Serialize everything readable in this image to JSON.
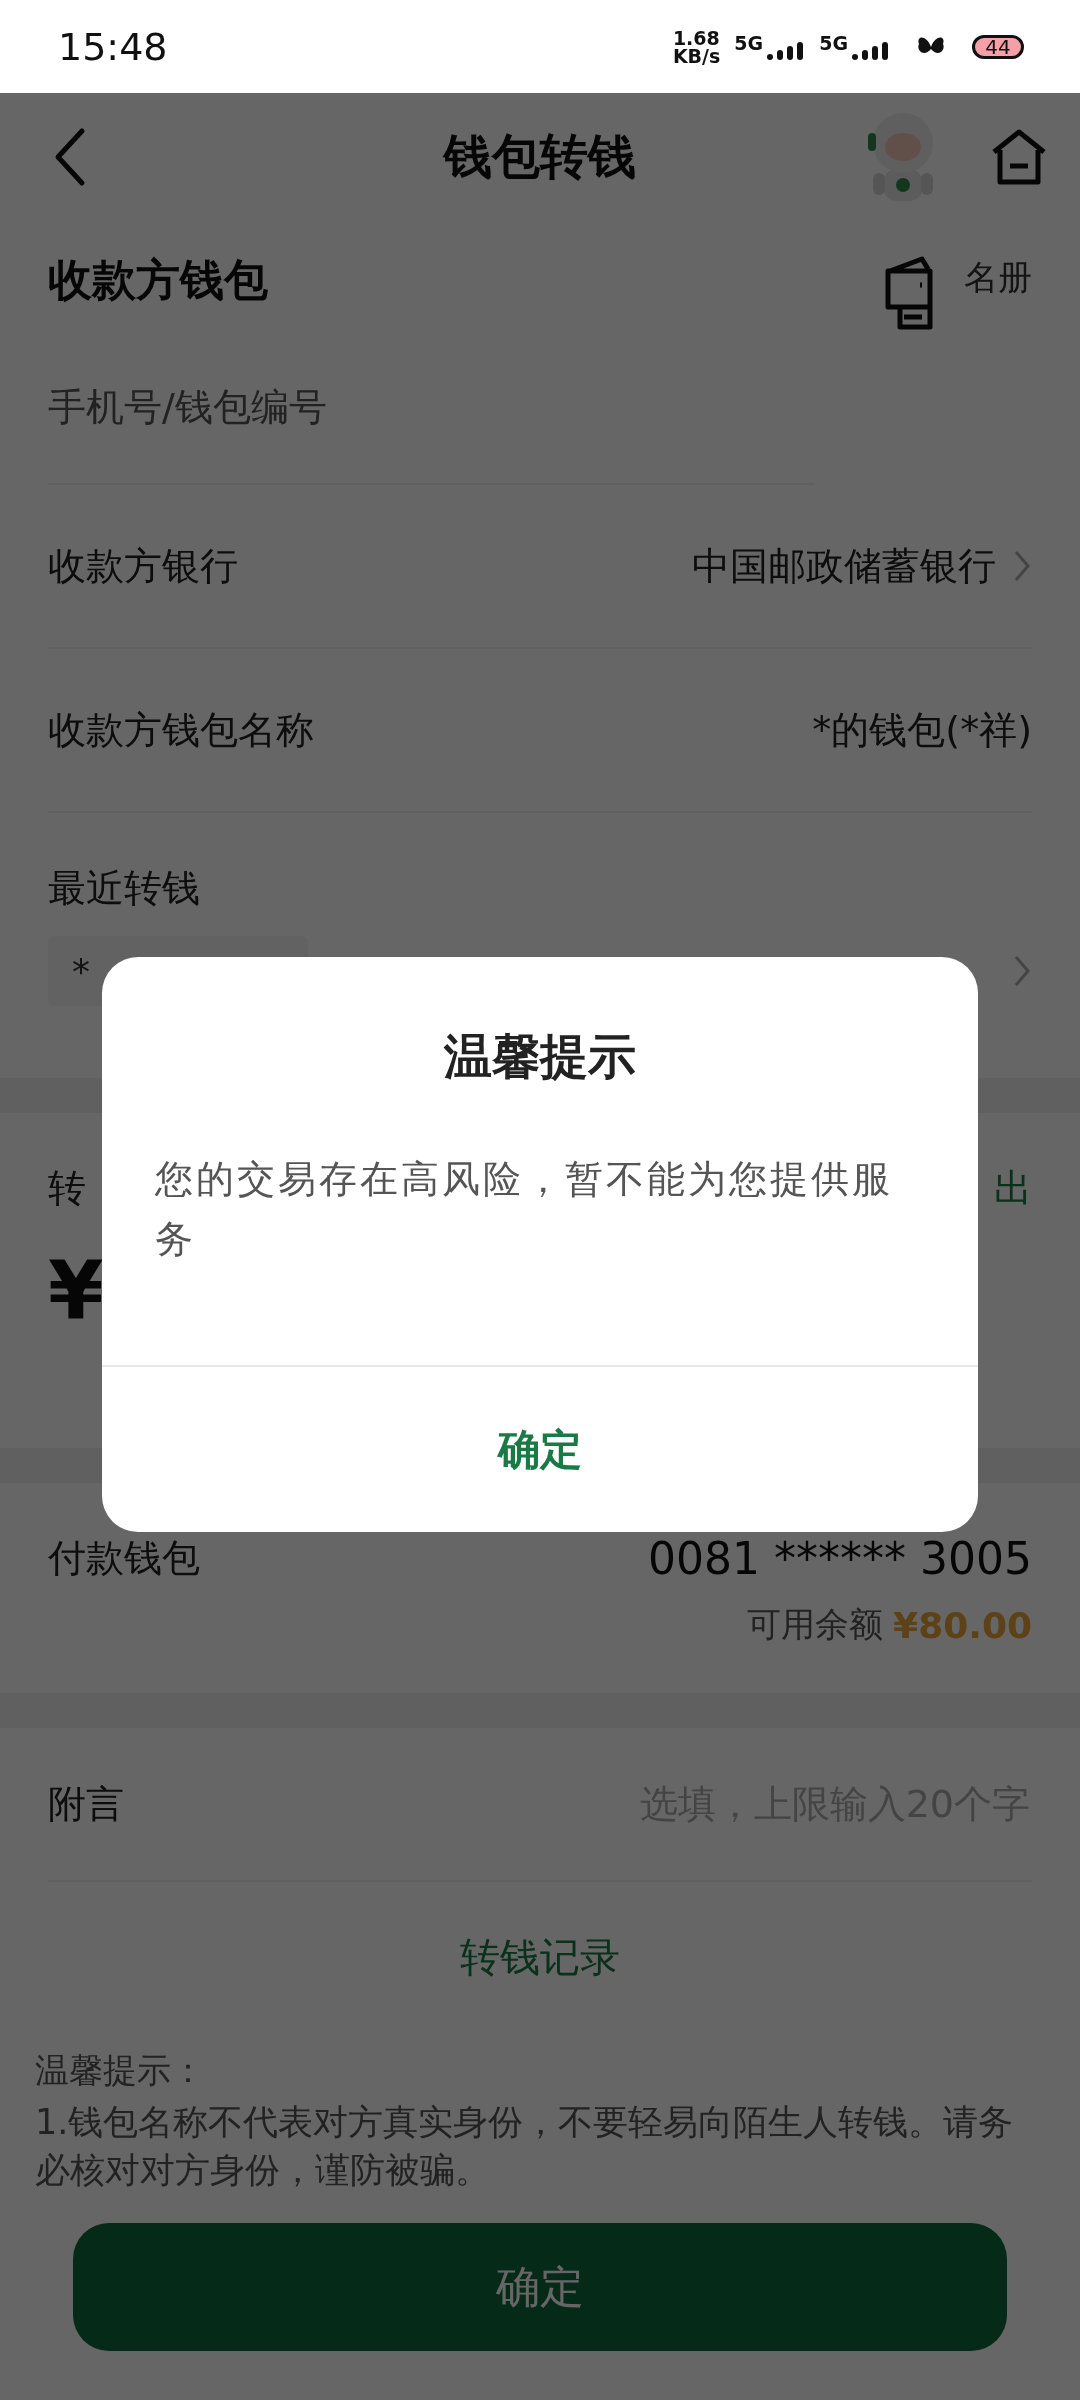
{
  "status_bar": {
    "time": "15:48",
    "net_speed": [
      "1.68",
      "KB/s"
    ],
    "signals": [
      {
        "label": "5G"
      },
      {
        "label": "5G"
      }
    ],
    "battery": "44"
  },
  "header": {
    "title": "钱包转钱"
  },
  "payee": {
    "title": "收款方钱包",
    "contacts": "名册",
    "account_field": {
      "placeholder": "手机号/钱包编号"
    },
    "rows": [
      {
        "label": "收款方银行",
        "value": "中国邮政储蓄银行",
        "chevron": true
      },
      {
        "label": "收款方钱包名称",
        "value": "*的钱包(*祥)",
        "chevron": false
      }
    ],
    "recent": {
      "title": "最近转钱",
      "chips": [
        "*"
      ]
    }
  },
  "amount": {
    "label": "转",
    "action": "出",
    "currency": "¥"
  },
  "payer": {
    "label": "付款钱包",
    "account": "0081 ****** 3005",
    "balance_label": "可用余额",
    "balance": "¥80.00"
  },
  "note": {
    "label": "附言",
    "placeholder": "选填，上限输入20个字"
  },
  "records_link": "转钱记录",
  "tips": {
    "title": "温馨提示：",
    "lines": [
      "1.钱包名称不代表对方真实身份，不要轻易向陌生人转钱。请务必核对对方身份，谨防被骗。"
    ]
  },
  "confirm_button": "确定",
  "dialog": {
    "title": "温馨提示",
    "message": "您的交易存在高风险，暂不能为您提供服务",
    "button": "确定"
  }
}
